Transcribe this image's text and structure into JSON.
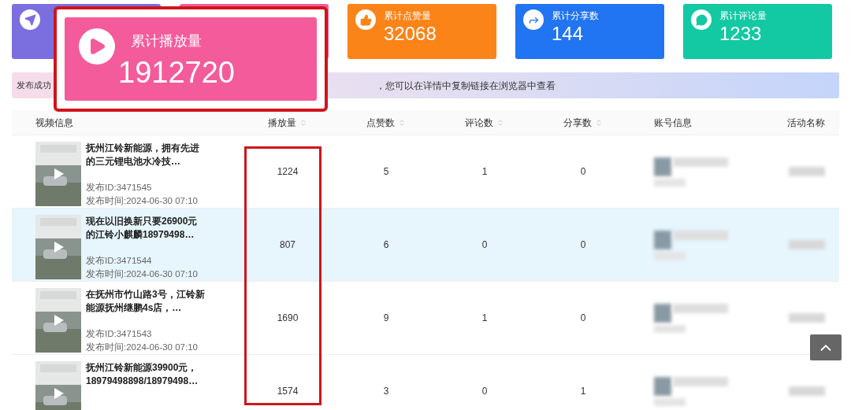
{
  "stat_cards": [
    {
      "kind": "send",
      "color": "#7b6fe0"
    },
    {
      "color": "#f45b9a"
    },
    {
      "kind": "like",
      "title": "累计点赞量",
      "value": "32068",
      "color": "#fb8419"
    },
    {
      "kind": "share",
      "title": "累计分享数",
      "value": "144",
      "color": "#2174f2"
    },
    {
      "kind": "comment",
      "title": "累计评论量",
      "value": "1233",
      "color": "#12c9a4"
    }
  ],
  "callout": {
    "kind": "play",
    "title": "累计播放量",
    "value": "1912720"
  },
  "notice": {
    "left": "发布成功",
    "right": "，您可以在详情中复制链接在浏览器中查看"
  },
  "table": {
    "columns": [
      {
        "label": "视频信息",
        "sortable": false
      },
      {
        "label": "播放量",
        "sortable": true
      },
      {
        "label": "点赞数",
        "sortable": true
      },
      {
        "label": "评论数",
        "sortable": true
      },
      {
        "label": "分享数",
        "sortable": true
      },
      {
        "label": "账号信息",
        "sortable": false
      },
      {
        "label": "活动名称",
        "sortable": false
      }
    ],
    "rows": [
      {
        "title": "抚州江铃新能源，拥有先进的三元锂电池水冷技…",
        "id": "发布ID:3471545",
        "time": "发布时间:2024-06-30 07:10",
        "plays": "1224",
        "likes": "5",
        "comments": "1",
        "shares": "0",
        "highlighted": false
      },
      {
        "title": "现在以旧换新只要26900元的江铃小麒麟18979498…",
        "id": "发布ID:3471544",
        "time": "发布时间:2024-06-30 07:10",
        "plays": "807",
        "likes": "6",
        "comments": "0",
        "shares": "0",
        "highlighted": true
      },
      {
        "title": "在抚州市竹山路3号，江铃新能源抚州继鹏4s店，…",
        "id": "发布ID:3471543",
        "time": "发布时间:2024-06-30 07:10",
        "plays": "1690",
        "likes": "9",
        "comments": "1",
        "shares": "0",
        "highlighted": false
      },
      {
        "title": "抚州江铃新能源39900元，18979498898/18979498…",
        "plays": "1574",
        "likes": "3",
        "comments": "0",
        "shares": "1",
        "highlighted": false
      }
    ]
  }
}
